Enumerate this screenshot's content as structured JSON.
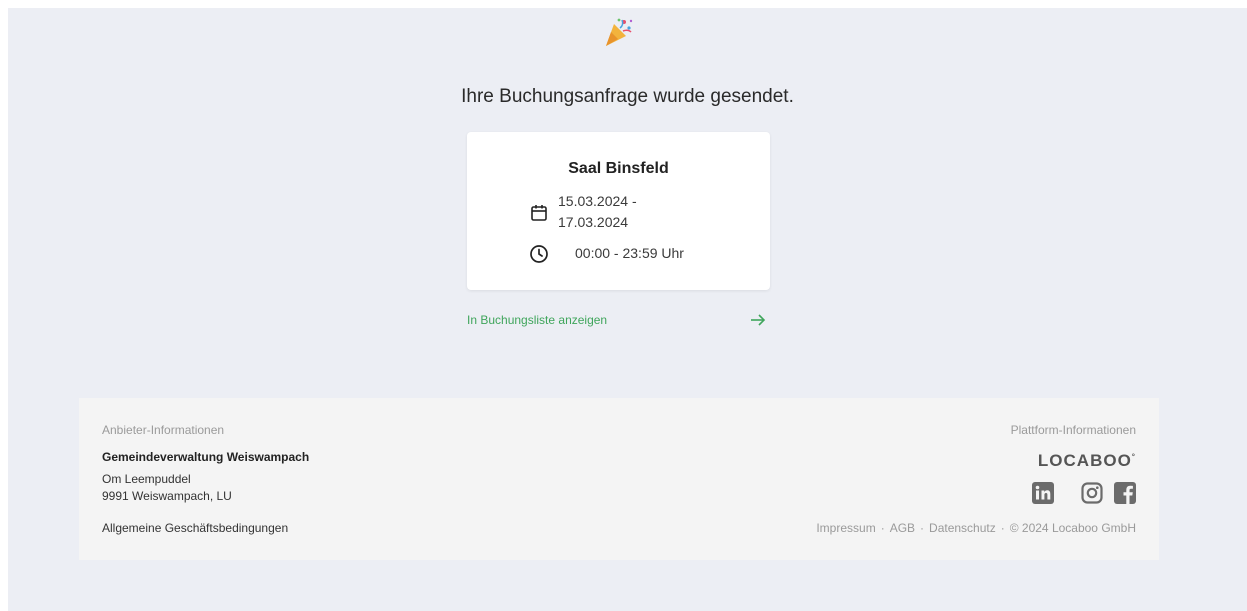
{
  "headline": "Ihre Buchungsanfrage wurde gesendet.",
  "booking": {
    "venue": "Saal Binsfeld",
    "date_start": "15.03.2024 -",
    "date_end": "17.03.2024",
    "time": "00:00 - 23:59 Uhr"
  },
  "link": {
    "label": "In Buchungsliste anzeigen"
  },
  "footer": {
    "provider_heading": "Anbieter-Informationen",
    "provider_name": "Gemeindeverwaltung Weiswampach",
    "address_line1": "Om Leempuddel",
    "address_line2": "9991 Weiswampach, LU",
    "terms": "Allgemeine Geschäftsbedingungen",
    "platform_heading": "Plattform-Informationen",
    "logo_text": "LOCABOO",
    "logo_mark": "°",
    "links": {
      "impressum": "Impressum",
      "agb": "AGB",
      "datenschutz": "Datenschutz",
      "copyright": "© 2024 Locaboo GmbH",
      "separator": "·"
    }
  },
  "colors": {
    "accent_green": "#3fa55b",
    "background": "#eceef4",
    "footer_bg": "#f4f4f4",
    "social_grey": "#6b6b6b"
  },
  "icons": [
    "party-popper-icon",
    "calendar-icon",
    "clock-icon",
    "arrow-right-icon",
    "linkedin-icon",
    "instagram-icon",
    "facebook-icon"
  ]
}
